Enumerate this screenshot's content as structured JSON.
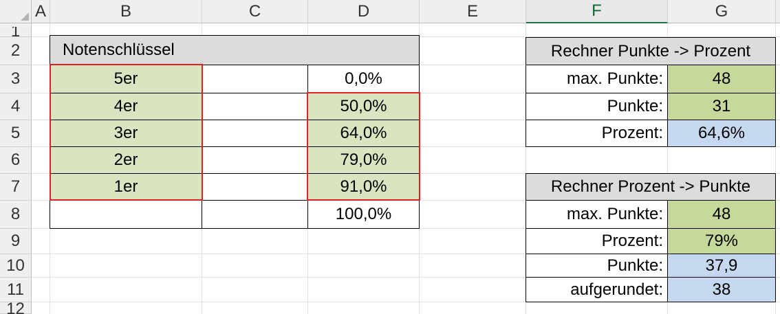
{
  "columns": [
    "A",
    "B",
    "C",
    "D",
    "E",
    "F",
    "G"
  ],
  "rows": [
    "1",
    "2",
    "3",
    "4",
    "5",
    "6",
    "7",
    "8",
    "9",
    "10",
    "11",
    "12"
  ],
  "selected_column": "F",
  "grade_key": {
    "title": "Notenschlüssel",
    "grades": [
      "5er",
      "4er",
      "3er",
      "2er",
      "1er"
    ],
    "percents": [
      "0,0%",
      "50,0%",
      "64,0%",
      "79,0%",
      "91,0%",
      "100,0%"
    ]
  },
  "calc1": {
    "title": "Rechner Punkte -> Prozent",
    "max_label": "max. Punkte:",
    "max_value": "48",
    "points_label": "Punkte:",
    "points_value": "31",
    "percent_label": "Prozent:",
    "percent_value": "64,6%"
  },
  "calc2": {
    "title": "Rechner Prozent -> Punkte",
    "max_label": "max. Punkte:",
    "max_value": "48",
    "percent_label": "Prozent:",
    "percent_value": "79%",
    "points_label": "Punkte:",
    "points_value": "37,9",
    "rounded_label": "aufgerundet:",
    "rounded_value": "38"
  },
  "colors": {
    "input_green": "#d9e4c0",
    "calc_green": "#c6d99b",
    "result_blue": "#c6d8ef",
    "title_gray": "#dcdcdc",
    "highlight_red": "#e02020"
  }
}
